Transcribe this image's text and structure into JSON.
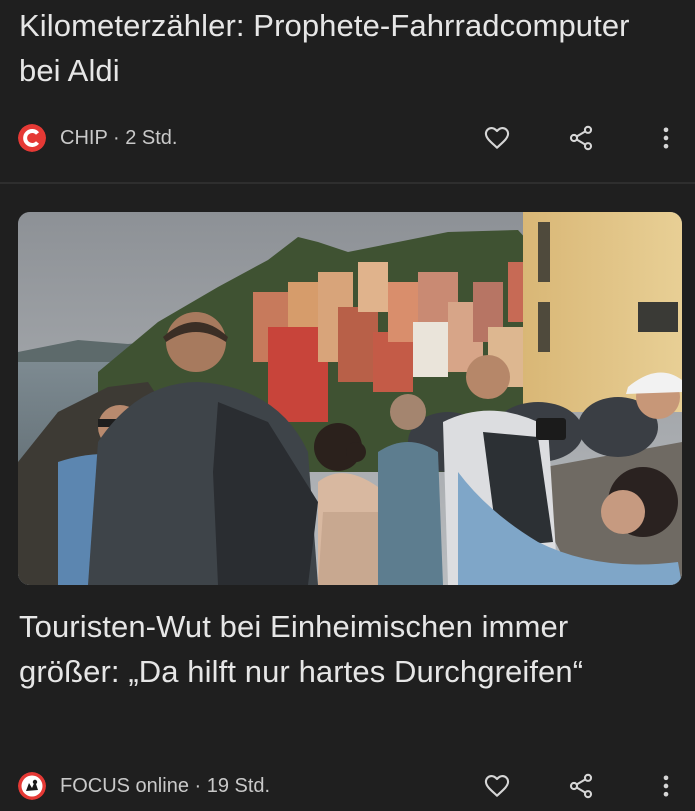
{
  "articles": [
    {
      "headline": "Kilometerzähler: Prophete-Fahrradcomputer bei Aldi",
      "source": "CHIP",
      "age": "2 Std.",
      "source_icon": "chip-logo-icon",
      "brand_color": "#e53935"
    },
    {
      "headline": "Touristen-Wut bei Einheimischen immer größer: „Da hilft nur hartes Durchgreifen“",
      "source": "FOCUS online",
      "age": "19 Std.",
      "source_icon": "focus-online-logo-icon",
      "brand_color": "#e53935",
      "image_description_icon": "news-photo"
    }
  ],
  "separator": " · ",
  "actions": {
    "like_icon": "heart-outline-icon",
    "share_icon": "share-icon",
    "more_icon": "more-vertical-icon"
  },
  "colors": {
    "background": "#1f1f1f",
    "text": "#e3e3e3",
    "meta_text": "#c9c9c9",
    "divider": "#2e2e2e"
  }
}
